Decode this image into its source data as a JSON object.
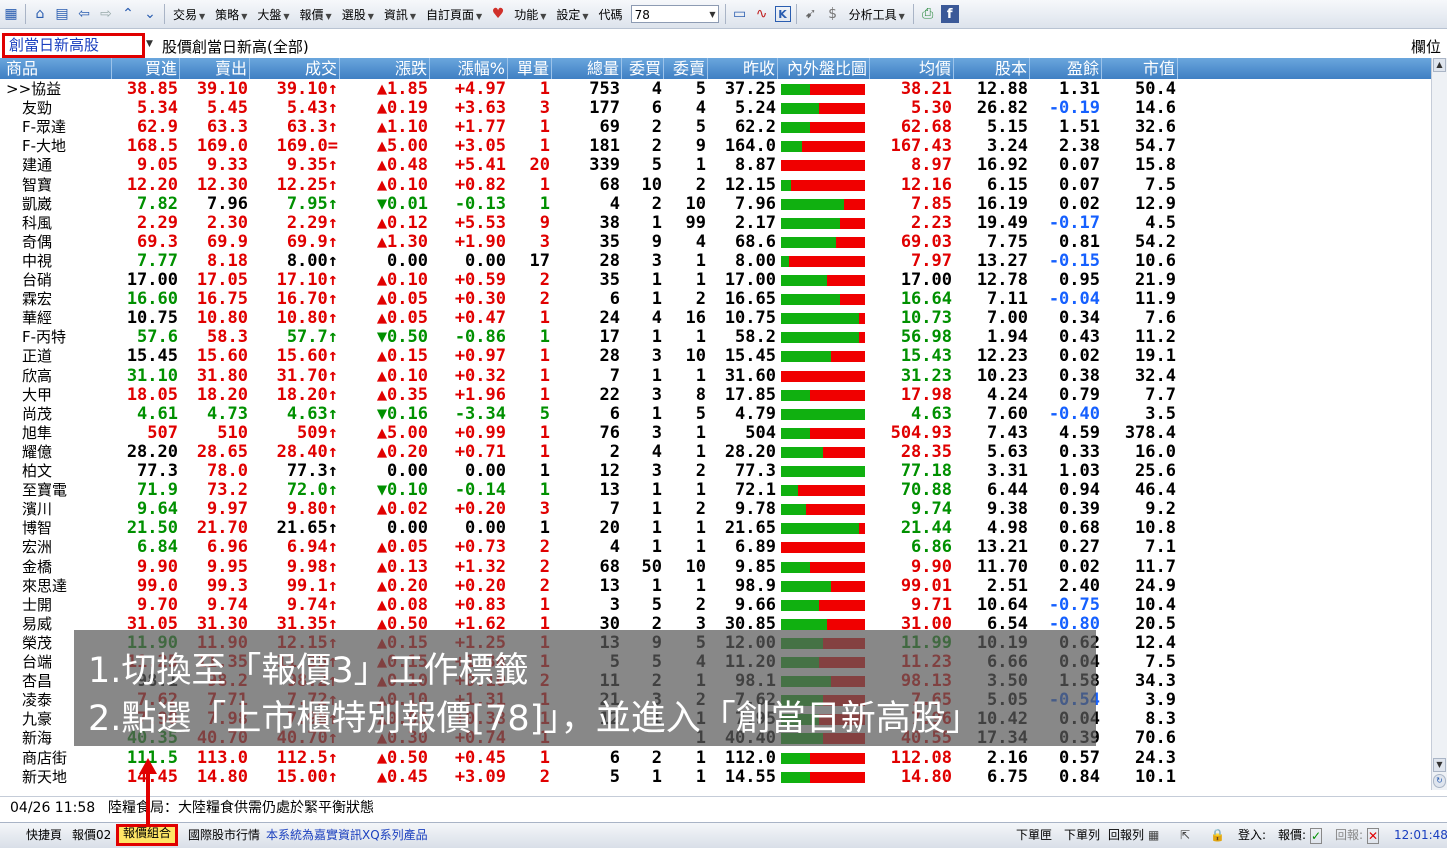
{
  "toolbar": {
    "menus": [
      "交易",
      "策略",
      "大盤",
      "報價",
      "選股",
      "資訊",
      "自訂頁面",
      "功能",
      "設定"
    ],
    "code_label": "代碼",
    "code_value": "78",
    "analysis_label": "分析工具"
  },
  "selector": {
    "group": "創當日新高股",
    "title": "股價創當日新高(全部)",
    "columns_button": "欄位"
  },
  "table": {
    "headers": [
      "商品",
      "買進",
      "賣出",
      "成交",
      "漲跌",
      "漲幅%",
      "單量",
      "總量",
      "委買",
      "委賣",
      "昨收",
      "內外盤比圖",
      "均價",
      "股本",
      "盈餘",
      "市值"
    ],
    "rows": [
      {
        "name": ">>協益",
        "buy": "38.85",
        "sell": "39.10",
        "deal": "39.10",
        "tick": "↑",
        "dir": "up",
        "chg": "1.85",
        "pct": "+4.97",
        "vol": "1",
        "total": "753",
        "bid": "4",
        "ask": "5",
        "prev": "37.25",
        "inner": 0.35,
        "avg": "38.21",
        "cap": "12.88",
        "eps": "1.31",
        "mkt": "50.4",
        "c": [
          "r",
          "r",
          "r",
          "r",
          "r",
          "r",
          "k",
          "k",
          "k",
          "k",
          "g",
          "r",
          "k",
          "k",
          "k"
        ],
        "epsc": "k"
      },
      {
        "name": "友勁",
        "buy": "5.34",
        "sell": "5.45",
        "deal": "5.43",
        "tick": "↑",
        "dir": "up",
        "chg": "0.19",
        "pct": "+3.63",
        "vol": "3",
        "total": "177",
        "bid": "6",
        "ask": "4",
        "prev": "5.24",
        "inner": 0.45,
        "avg": "5.30",
        "c": [
          "r",
          "r",
          "r",
          "r",
          "r",
          "r"
        ],
        "cap": "26.82",
        "eps": "-0.19",
        "mkt": "14.6",
        "epsc": "b"
      },
      {
        "name": "F-眾達",
        "buy": "62.9",
        "sell": "63.3",
        "deal": "63.3",
        "tick": "↑",
        "dir": "up",
        "chg": "1.10",
        "pct": "+1.77",
        "vol": "1",
        "total": "69",
        "bid": "2",
        "ask": "5",
        "prev": "62.2",
        "inner": 0.35,
        "avg": "62.68",
        "cap": "5.15",
        "eps": "1.51",
        "mkt": "32.6",
        "epsc": "k"
      },
      {
        "name": "F-大地",
        "buy": "168.5",
        "sell": "169.0",
        "deal": "169.0",
        "tick": "=",
        "dir": "up",
        "chg": "5.00",
        "pct": "+3.05",
        "vol": "1",
        "total": "181",
        "bid": "2",
        "ask": "9",
        "prev": "164.0",
        "inner": 0.25,
        "avg": "167.43",
        "cap": "3.24",
        "eps": "2.38",
        "mkt": "54.7",
        "epsc": "k"
      },
      {
        "name": "建通",
        "buy": "9.05",
        "sell": "9.33",
        "deal": "9.35",
        "tick": "↑",
        "dir": "up",
        "chg": "0.48",
        "pct": "+5.41",
        "vol": "20",
        "total": "339",
        "bid": "5",
        "ask": "1",
        "prev": "8.87",
        "inner": 0.0,
        "avg": "8.97",
        "cap": "16.92",
        "eps": "0.07",
        "mkt": "15.8",
        "epsc": "k"
      },
      {
        "name": "智寶",
        "buy": "12.20",
        "sell": "12.30",
        "deal": "12.25",
        "tick": "↑",
        "dir": "up",
        "chg": "0.10",
        "pct": "+0.82",
        "vol": "1",
        "total": "68",
        "bid": "10",
        "ask": "2",
        "prev": "12.15",
        "inner": 0.12,
        "avg": "12.16",
        "cap": "6.15",
        "eps": "0.07",
        "mkt": "7.5",
        "epsc": "k"
      },
      {
        "name": "凱崴",
        "buy": "7.82",
        "sell": "7.96",
        "deal": "7.95",
        "tick": "↑",
        "dir": "dn",
        "chg": "0.01",
        "pct": "-0.13",
        "vol": "1",
        "total": "4",
        "bid": "2",
        "ask": "10",
        "prev": "7.96",
        "inner": 0.75,
        "avg": "7.85",
        "cap": "16.19",
        "eps": "0.02",
        "mkt": "12.9",
        "epsc": "k",
        "bc": "g",
        "sc": "k",
        "dc": "g"
      },
      {
        "name": "科風",
        "buy": "2.29",
        "sell": "2.30",
        "deal": "2.29",
        "tick": "↑",
        "dir": "up",
        "chg": "0.12",
        "pct": "+5.53",
        "vol": "9",
        "total": "38",
        "bid": "1",
        "ask": "99",
        "prev": "2.17",
        "inner": 0.7,
        "avg": "2.23",
        "cap": "19.49",
        "eps": "-0.17",
        "mkt": "4.5",
        "epsc": "b"
      },
      {
        "name": "奇偶",
        "buy": "69.3",
        "sell": "69.9",
        "deal": "69.9",
        "tick": "↑",
        "dir": "up",
        "chg": "1.30",
        "pct": "+1.90",
        "vol": "3",
        "total": "35",
        "bid": "9",
        "ask": "4",
        "prev": "68.6",
        "inner": 0.65,
        "avg": "69.03",
        "cap": "7.75",
        "eps": "0.81",
        "mkt": "54.2",
        "epsc": "k"
      },
      {
        "name": "中視",
        "buy": "7.77",
        "sell": "8.18",
        "deal": "8.00",
        "tick": "↑",
        "dir": "flat",
        "chg": "0.00",
        "pct": "0.00",
        "vol": "17",
        "total": "28",
        "bid": "3",
        "ask": "1",
        "prev": "8.00",
        "inner": 0.1,
        "avg": "7.97",
        "cap": "13.27",
        "eps": "-0.15",
        "mkt": "10.6",
        "epsc": "b",
        "bc": "g",
        "sc": "r",
        "dc": "k"
      },
      {
        "name": "台硝",
        "buy": "17.00",
        "sell": "17.05",
        "deal": "17.10",
        "tick": "↑",
        "dir": "up",
        "chg": "0.10",
        "pct": "+0.59",
        "vol": "2",
        "total": "35",
        "bid": "1",
        "ask": "1",
        "prev": "17.00",
        "inner": 0.55,
        "avg": "17.00",
        "cap": "12.78",
        "eps": "0.95",
        "mkt": "21.9",
        "epsc": "k",
        "bc": "k",
        "avgc": "k"
      },
      {
        "name": "霖宏",
        "buy": "16.60",
        "sell": "16.75",
        "deal": "16.70",
        "tick": "↑",
        "dir": "up",
        "chg": "0.05",
        "pct": "+0.30",
        "vol": "2",
        "total": "6",
        "bid": "1",
        "ask": "2",
        "prev": "16.65",
        "inner": 0.7,
        "avg": "16.64",
        "cap": "7.11",
        "eps": "-0.04",
        "mkt": "11.9",
        "epsc": "b",
        "bc": "g",
        "avgc": "g"
      },
      {
        "name": "華經",
        "buy": "10.75",
        "sell": "10.80",
        "deal": "10.80",
        "tick": "↑",
        "dir": "up",
        "chg": "0.05",
        "pct": "+0.47",
        "vol": "1",
        "total": "24",
        "bid": "4",
        "ask": "16",
        "prev": "10.75",
        "inner": 0.93,
        "avg": "10.73",
        "cap": "7.00",
        "eps": "0.34",
        "mkt": "7.6",
        "epsc": "k",
        "bc": "k",
        "avgc": "g"
      },
      {
        "name": "F-丙特",
        "buy": "57.6",
        "sell": "58.3",
        "deal": "57.7",
        "tick": "↑",
        "dir": "dn",
        "chg": "0.50",
        "pct": "-0.86",
        "vol": "1",
        "total": "17",
        "bid": "1",
        "ask": "1",
        "prev": "58.2",
        "inner": 0.93,
        "avg": "56.98",
        "cap": "1.94",
        "eps": "0.43",
        "mkt": "11.2",
        "epsc": "k",
        "bc": "g",
        "dc": "g",
        "avgc": "g"
      },
      {
        "name": "正道",
        "buy": "15.45",
        "sell": "15.60",
        "deal": "15.60",
        "tick": "↑",
        "dir": "up",
        "chg": "0.15",
        "pct": "+0.97",
        "vol": "1",
        "total": "28",
        "bid": "3",
        "ask": "10",
        "prev": "15.45",
        "inner": 0.6,
        "avg": "15.43",
        "cap": "12.23",
        "eps": "0.02",
        "mkt": "19.1",
        "epsc": "k",
        "bc": "k",
        "avgc": "g"
      },
      {
        "name": "欣高",
        "buy": "31.10",
        "sell": "31.80",
        "deal": "31.70",
        "tick": "↑",
        "dir": "up",
        "chg": "0.10",
        "pct": "+0.32",
        "vol": "1",
        "total": "7",
        "bid": "1",
        "ask": "1",
        "prev": "31.60",
        "inner": 0.0,
        "avg": "31.23",
        "cap": "10.23",
        "eps": "0.38",
        "mkt": "32.4",
        "epsc": "k",
        "bc": "g",
        "avgc": "g"
      },
      {
        "name": "大甲",
        "buy": "18.05",
        "sell": "18.20",
        "deal": "18.20",
        "tick": "↑",
        "dir": "up",
        "chg": "0.35",
        "pct": "+1.96",
        "vol": "1",
        "total": "22",
        "bid": "3",
        "ask": "8",
        "prev": "17.85",
        "inner": 0.35,
        "avg": "17.98",
        "cap": "4.24",
        "eps": "0.79",
        "mkt": "7.7",
        "epsc": "k"
      },
      {
        "name": "尚茂",
        "buy": "4.61",
        "sell": "4.73",
        "deal": "4.63",
        "tick": "↑",
        "dir": "dn",
        "chg": "0.16",
        "pct": "-3.34",
        "vol": "5",
        "total": "6",
        "bid": "1",
        "ask": "5",
        "prev": "4.79",
        "inner": 1.0,
        "avg": "4.63",
        "cap": "7.60",
        "eps": "-0.40",
        "mkt": "3.5",
        "epsc": "b",
        "bc": "g",
        "sc": "g",
        "dc": "g",
        "avgc": "g"
      },
      {
        "name": "旭隼",
        "buy": "507",
        "sell": "510",
        "deal": "509",
        "tick": "↑",
        "dir": "up",
        "chg": "5.00",
        "pct": "+0.99",
        "vol": "1",
        "total": "76",
        "bid": "3",
        "ask": "1",
        "prev": "504",
        "inner": 0.35,
        "avg": "504.93",
        "cap": "7.43",
        "eps": "4.59",
        "mkt": "378.4",
        "epsc": "k"
      },
      {
        "name": "耀億",
        "buy": "28.20",
        "sell": "28.65",
        "deal": "28.40",
        "tick": "↑",
        "dir": "up",
        "chg": "0.20",
        "pct": "+0.71",
        "vol": "1",
        "total": "2",
        "bid": "4",
        "ask": "1",
        "prev": "28.20",
        "inner": 0.5,
        "avg": "28.35",
        "cap": "5.63",
        "eps": "0.33",
        "mkt": "16.0",
        "epsc": "k",
        "bc": "k"
      },
      {
        "name": "柏文",
        "buy": "77.3",
        "sell": "78.0",
        "deal": "77.3",
        "tick": "↑",
        "dir": "flat",
        "chg": "0.00",
        "pct": "0.00",
        "vol": "1",
        "total": "12",
        "bid": "3",
        "ask": "2",
        "prev": "77.3",
        "inner": 1.0,
        "avg": "77.18",
        "cap": "3.31",
        "eps": "1.03",
        "mkt": "25.6",
        "epsc": "k",
        "bc": "k",
        "dc": "k",
        "avgc": "g"
      },
      {
        "name": "至寶電",
        "buy": "71.9",
        "sell": "73.2",
        "deal": "72.0",
        "tick": "↑",
        "dir": "dn",
        "chg": "0.10",
        "pct": "-0.14",
        "vol": "1",
        "total": "13",
        "bid": "1",
        "ask": "1",
        "prev": "72.1",
        "inner": 0.2,
        "avg": "70.88",
        "cap": "6.44",
        "eps": "0.94",
        "mkt": "46.4",
        "epsc": "k",
        "bc": "g",
        "dc": "g",
        "avgc": "g"
      },
      {
        "name": "濱川",
        "buy": "9.64",
        "sell": "9.97",
        "deal": "9.80",
        "tick": "↑",
        "dir": "up",
        "chg": "0.02",
        "pct": "+0.20",
        "vol": "3",
        "total": "7",
        "bid": "1",
        "ask": "2",
        "prev": "9.78",
        "inner": 0.3,
        "avg": "9.74",
        "cap": "9.38",
        "eps": "0.39",
        "mkt": "9.2",
        "epsc": "k",
        "bc": "g",
        "avgc": "g"
      },
      {
        "name": "博智",
        "buy": "21.50",
        "sell": "21.70",
        "deal": "21.65",
        "tick": "↑",
        "dir": "flat",
        "chg": "0.00",
        "pct": "0.00",
        "vol": "1",
        "total": "20",
        "bid": "1",
        "ask": "1",
        "prev": "21.65",
        "inner": 0.93,
        "avg": "21.44",
        "cap": "4.98",
        "eps": "0.68",
        "mkt": "10.8",
        "epsc": "k",
        "bc": "g",
        "dc": "k",
        "avgc": "g"
      },
      {
        "name": "宏洲",
        "buy": "6.84",
        "sell": "6.96",
        "deal": "6.94",
        "tick": "↑",
        "dir": "up",
        "chg": "0.05",
        "pct": "+0.73",
        "vol": "2",
        "total": "4",
        "bid": "1",
        "ask": "1",
        "prev": "6.89",
        "inner": 0.0,
        "avg": "6.86",
        "cap": "13.21",
        "eps": "0.27",
        "mkt": "7.1",
        "epsc": "k",
        "bc": "g",
        "avgc": "g"
      },
      {
        "name": "金橋",
        "buy": "9.90",
        "sell": "9.95",
        "deal": "9.98",
        "tick": "↑",
        "dir": "up",
        "chg": "0.13",
        "pct": "+1.32",
        "vol": "2",
        "total": "68",
        "bid": "50",
        "ask": "10",
        "prev": "9.85",
        "inner": 0.35,
        "avg": "9.90",
        "cap": "11.70",
        "eps": "0.02",
        "mkt": "11.7",
        "epsc": "k"
      },
      {
        "name": "來思達",
        "buy": "99.0",
        "sell": "99.3",
        "deal": "99.1",
        "tick": "↑",
        "dir": "up",
        "chg": "0.20",
        "pct": "+0.20",
        "vol": "2",
        "total": "13",
        "bid": "1",
        "ask": "1",
        "prev": "98.9",
        "inner": 0.6,
        "avg": "99.01",
        "cap": "2.51",
        "eps": "2.40",
        "mkt": "24.9",
        "epsc": "k"
      },
      {
        "name": "士開",
        "buy": "9.70",
        "sell": "9.74",
        "deal": "9.74",
        "tick": "↑",
        "dir": "up",
        "chg": "0.08",
        "pct": "+0.83",
        "vol": "1",
        "total": "3",
        "bid": "5",
        "ask": "2",
        "prev": "9.66",
        "inner": 0.45,
        "avg": "9.71",
        "cap": "10.64",
        "eps": "-0.75",
        "mkt": "10.4",
        "epsc": "b"
      },
      {
        "name": "易威",
        "buy": "31.05",
        "sell": "31.30",
        "deal": "31.35",
        "tick": "↑",
        "dir": "up",
        "chg": "0.50",
        "pct": "+1.62",
        "vol": "1",
        "total": "30",
        "bid": "2",
        "ask": "3",
        "prev": "30.85",
        "inner": 0.55,
        "avg": "31.00",
        "cap": "6.54",
        "eps": "-0.80",
        "mkt": "20.5",
        "epsc": "b"
      },
      {
        "name": "榮茂",
        "buy": "11.90",
        "sell": "11.90",
        "deal": "12.15",
        "tick": "↑",
        "dir": "up",
        "chg": "0.15",
        "pct": "+1.25",
        "vol": "1",
        "total": "13",
        "bid": "9",
        "ask": "5",
        "prev": "12.00",
        "inner": 0.5,
        "avg": "11.99",
        "cap": "10.19",
        "eps": "0.62",
        "mkt": "12.4",
        "epsc": "k",
        "bc": "g",
        "avgc": "g"
      },
      {
        "name": "台端",
        "buy": "11.25",
        "sell": "11.35",
        "deal": "11.35",
        "tick": "↑",
        "dir": "up",
        "chg": "0.15",
        "pct": "+1.34",
        "vol": "1",
        "total": "5",
        "bid": "5",
        "ask": "4",
        "prev": "11.20",
        "inner": 0.45,
        "avg": "11.23",
        "cap": "6.66",
        "eps": "0.04",
        "mkt": "7.5",
        "epsc": "k"
      },
      {
        "name": "杏昌",
        "buy": "98.1",
        "sell": "98.2",
        "deal": "98.2",
        "tick": "↑",
        "dir": "up",
        "chg": "0.10",
        "pct": "+0.10",
        "vol": "2",
        "total": "11",
        "bid": "2",
        "ask": "1",
        "prev": "98.1",
        "inner": 0.6,
        "avg": "98.13",
        "cap": "3.50",
        "eps": "1.58",
        "mkt": "34.3",
        "epsc": "k",
        "bc": "k"
      },
      {
        "name": "凌泰",
        "buy": "7.62",
        "sell": "7.71",
        "deal": "7.72",
        "tick": "↑",
        "dir": "up",
        "chg": "0.10",
        "pct": "+1.31",
        "vol": "1",
        "total": "21",
        "bid": "3",
        "ask": "2",
        "prev": "7.62",
        "inner": 0.5,
        "avg": "7.65",
        "cap": "5.05",
        "eps": "-0.54",
        "mkt": "3.9",
        "epsc": "b"
      },
      {
        "name": "九豪",
        "buy": "7.98",
        "sell": "7.98",
        "deal": "7.98",
        "tick": "↑",
        "dir": "up",
        "chg": "0.03",
        "pct": "+0.38",
        "vol": "1",
        "total": "12",
        "bid": "1",
        "ask": "1",
        "prev": "7.95",
        "inner": 0.45,
        "avg": "7.96",
        "cap": "10.42",
        "eps": "0.04",
        "mkt": "8.3",
        "epsc": "k"
      },
      {
        "name": "新海",
        "buy": "40.35",
        "sell": "40.70",
        "deal": "40.70",
        "tick": "↑",
        "dir": "up",
        "chg": "0.30",
        "pct": "+0.74",
        "vol": "1",
        "total": "",
        "bid": "",
        "ask": "1",
        "prev": "40.40",
        "inner": 0.5,
        "avg": "40.55",
        "cap": "17.34",
        "eps": "0.39",
        "mkt": "70.6",
        "epsc": "k",
        "bc": "g"
      },
      {
        "name": "商店街",
        "buy": "111.5",
        "sell": "113.0",
        "deal": "112.5",
        "tick": "↑",
        "dir": "up",
        "chg": "0.50",
        "pct": "+0.45",
        "vol": "1",
        "total": "6",
        "bid": "2",
        "ask": "1",
        "prev": "112.0",
        "inner": 0.35,
        "avg": "112.08",
        "cap": "2.16",
        "eps": "0.57",
        "mkt": "24.3",
        "epsc": "k",
        "bc": "g"
      },
      {
        "name": "新天地",
        "buy": "14.45",
        "sell": "14.80",
        "deal": "15.00",
        "tick": "↑",
        "dir": "up",
        "chg": "0.45",
        "pct": "+3.09",
        "vol": "2",
        "total": "5",
        "bid": "1",
        "ask": "1",
        "prev": "14.55",
        "inner": 0.35,
        "avg": "14.80",
        "cap": "6.75",
        "eps": "0.84",
        "mkt": "10.1",
        "epsc": "k"
      }
    ]
  },
  "colors": {
    "up": "#e00000",
    "down": "#009000",
    "flat": "#000000",
    "neg_eps": "#1560ff",
    "header_bg": "#4f8fcf"
  },
  "news": {
    "time": "04/26 11:58",
    "text": "陸糧食局：大陸糧食供需仍處於緊平衡狀態"
  },
  "status": {
    "tabs": [
      "快捷頁",
      "報價02",
      "報價組合",
      "國際股市行情"
    ],
    "marquee": "本系統為嘉實資訊XQ系列產品",
    "right_items": [
      "下單匣",
      "下單列",
      "回報列"
    ],
    "login_label": "登入:",
    "quote_label": "報價:",
    "report_label": "回報:",
    "clock": "12:01:48"
  },
  "overlay": {
    "line1": "1.切換至「報價3」工作標籤",
    "line2": "2.點選「上市櫃特別報價[78]」，並進入「創當日新高股」"
  }
}
